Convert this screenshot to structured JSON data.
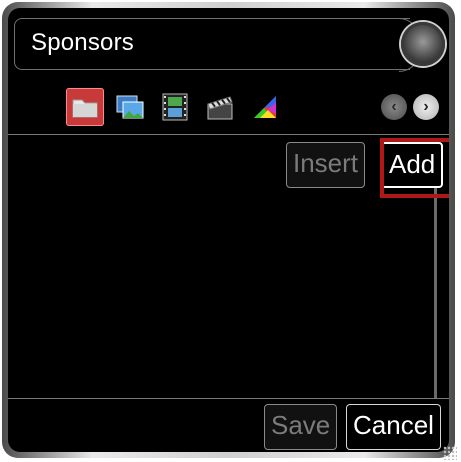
{
  "window": {
    "title": "Sponsors"
  },
  "toolbar": {
    "icons": [
      {
        "name": "folder-icon",
        "active": true
      },
      {
        "name": "images-icon",
        "active": false
      },
      {
        "name": "filmstrip-icon",
        "active": false
      },
      {
        "name": "clapperboard-icon",
        "active": false
      },
      {
        "name": "color-palette-icon",
        "active": false
      }
    ],
    "prev_label": "‹",
    "next_label": "›"
  },
  "list": {
    "insert_label": "Insert",
    "add_label": "Add"
  },
  "footer": {
    "save_label": "Save",
    "cancel_label": "Cancel"
  },
  "colors": {
    "highlight": "#b01818",
    "active_icon": "#c83a3a",
    "background": "#000000"
  }
}
